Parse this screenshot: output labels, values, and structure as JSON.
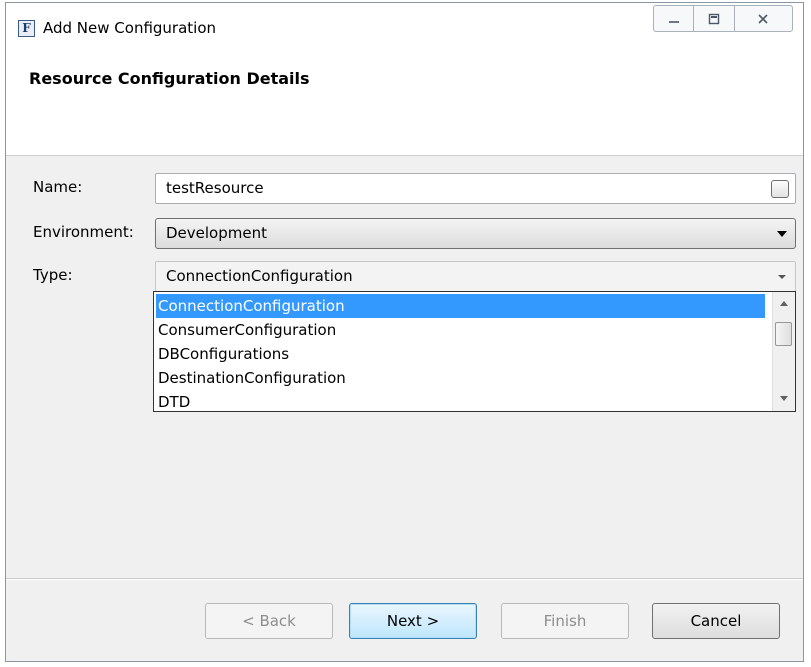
{
  "window": {
    "title": "Add New Configuration",
    "icon_letter": "F",
    "controls": [
      "minimize-icon",
      "maximize-icon",
      "close-icon"
    ]
  },
  "banner": {
    "title": "Resource Configuration Details"
  },
  "form": {
    "name_label": "Name:",
    "name_value": "testResource",
    "environment_label": "Environment:",
    "environment_value": "Development",
    "type_label": "Type:",
    "type_value": "ConnectionConfiguration"
  },
  "type_dropdown": {
    "items": [
      "ConnectionConfiguration",
      "ConsumerConfiguration",
      "DBConfigurations",
      "DestinationConfiguration",
      "DTD"
    ],
    "selected_index": 0
  },
  "buttons": {
    "back": "< Back",
    "next": "Next >",
    "finish": "Finish",
    "cancel": "Cancel"
  },
  "colors": {
    "selection": "#3399ff",
    "default_button": "#bee6fd"
  }
}
